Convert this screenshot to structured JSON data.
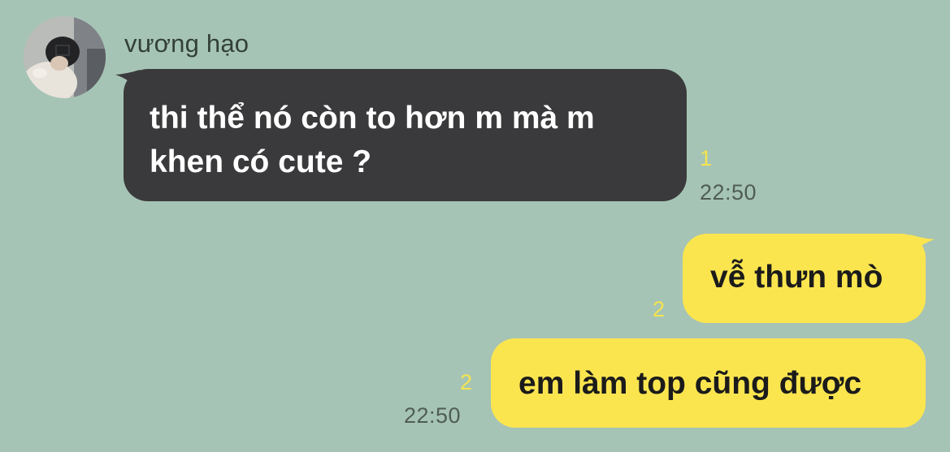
{
  "conversation": {
    "sender_name": "vương hạo",
    "messages": [
      {
        "direction": "incoming",
        "lines": [
          "thi thể nó còn to hơn m mà m",
          "khen có cute ?"
        ],
        "unread_count": "1",
        "time": "22:50"
      },
      {
        "direction": "outgoing",
        "text": "vễ thưn mò",
        "unread_count": "2"
      },
      {
        "direction": "outgoing",
        "text": "em làm top cũng được",
        "unread_count": "2",
        "time": "22:50"
      }
    ]
  },
  "colors": {
    "background": "#a6c4b5",
    "incoming_bubble": "#3a3a3c",
    "outgoing_bubble": "#fbe54f",
    "unread_count": "#f4e44e",
    "timestamp": "#4f5d56"
  },
  "icons": {
    "avatar": "profile-photo"
  }
}
